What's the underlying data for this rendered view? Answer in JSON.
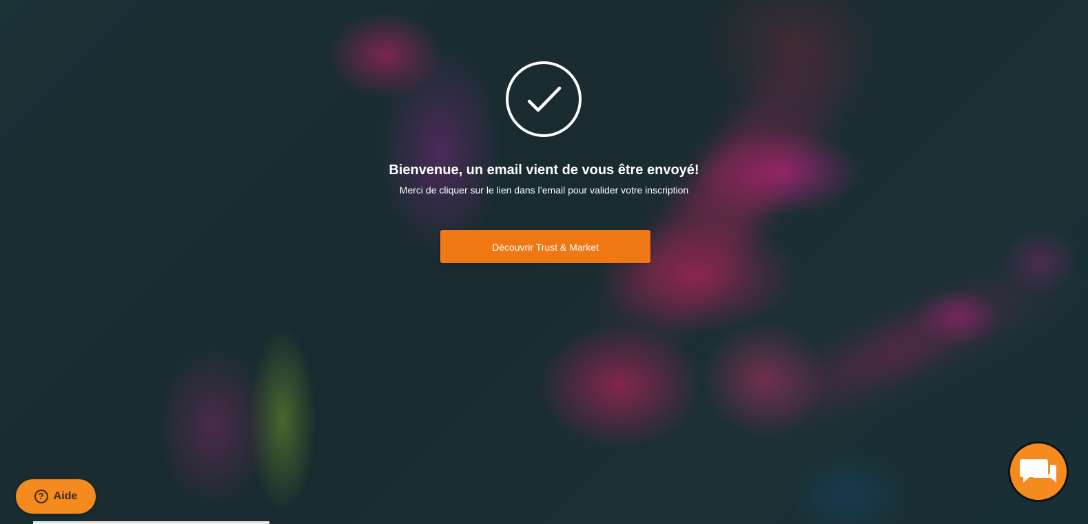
{
  "confirmation": {
    "icon": "check-circle-icon",
    "title": "Bienvenue, un email vient de vous être envoyé!",
    "subtitle": "Merci de cliquer sur le lien dans l’email pour valider votre inscription",
    "cta_label": "Découvrir Trust & Market"
  },
  "help_widget": {
    "icon": "question-circle-icon",
    "icon_glyph": "?",
    "label": "Aide"
  },
  "chat_widget": {
    "icon": "chat-bubbles-icon"
  },
  "colors": {
    "accent": "#f07814",
    "widget_orange": "#f58a1f",
    "text": "#ffffff"
  }
}
